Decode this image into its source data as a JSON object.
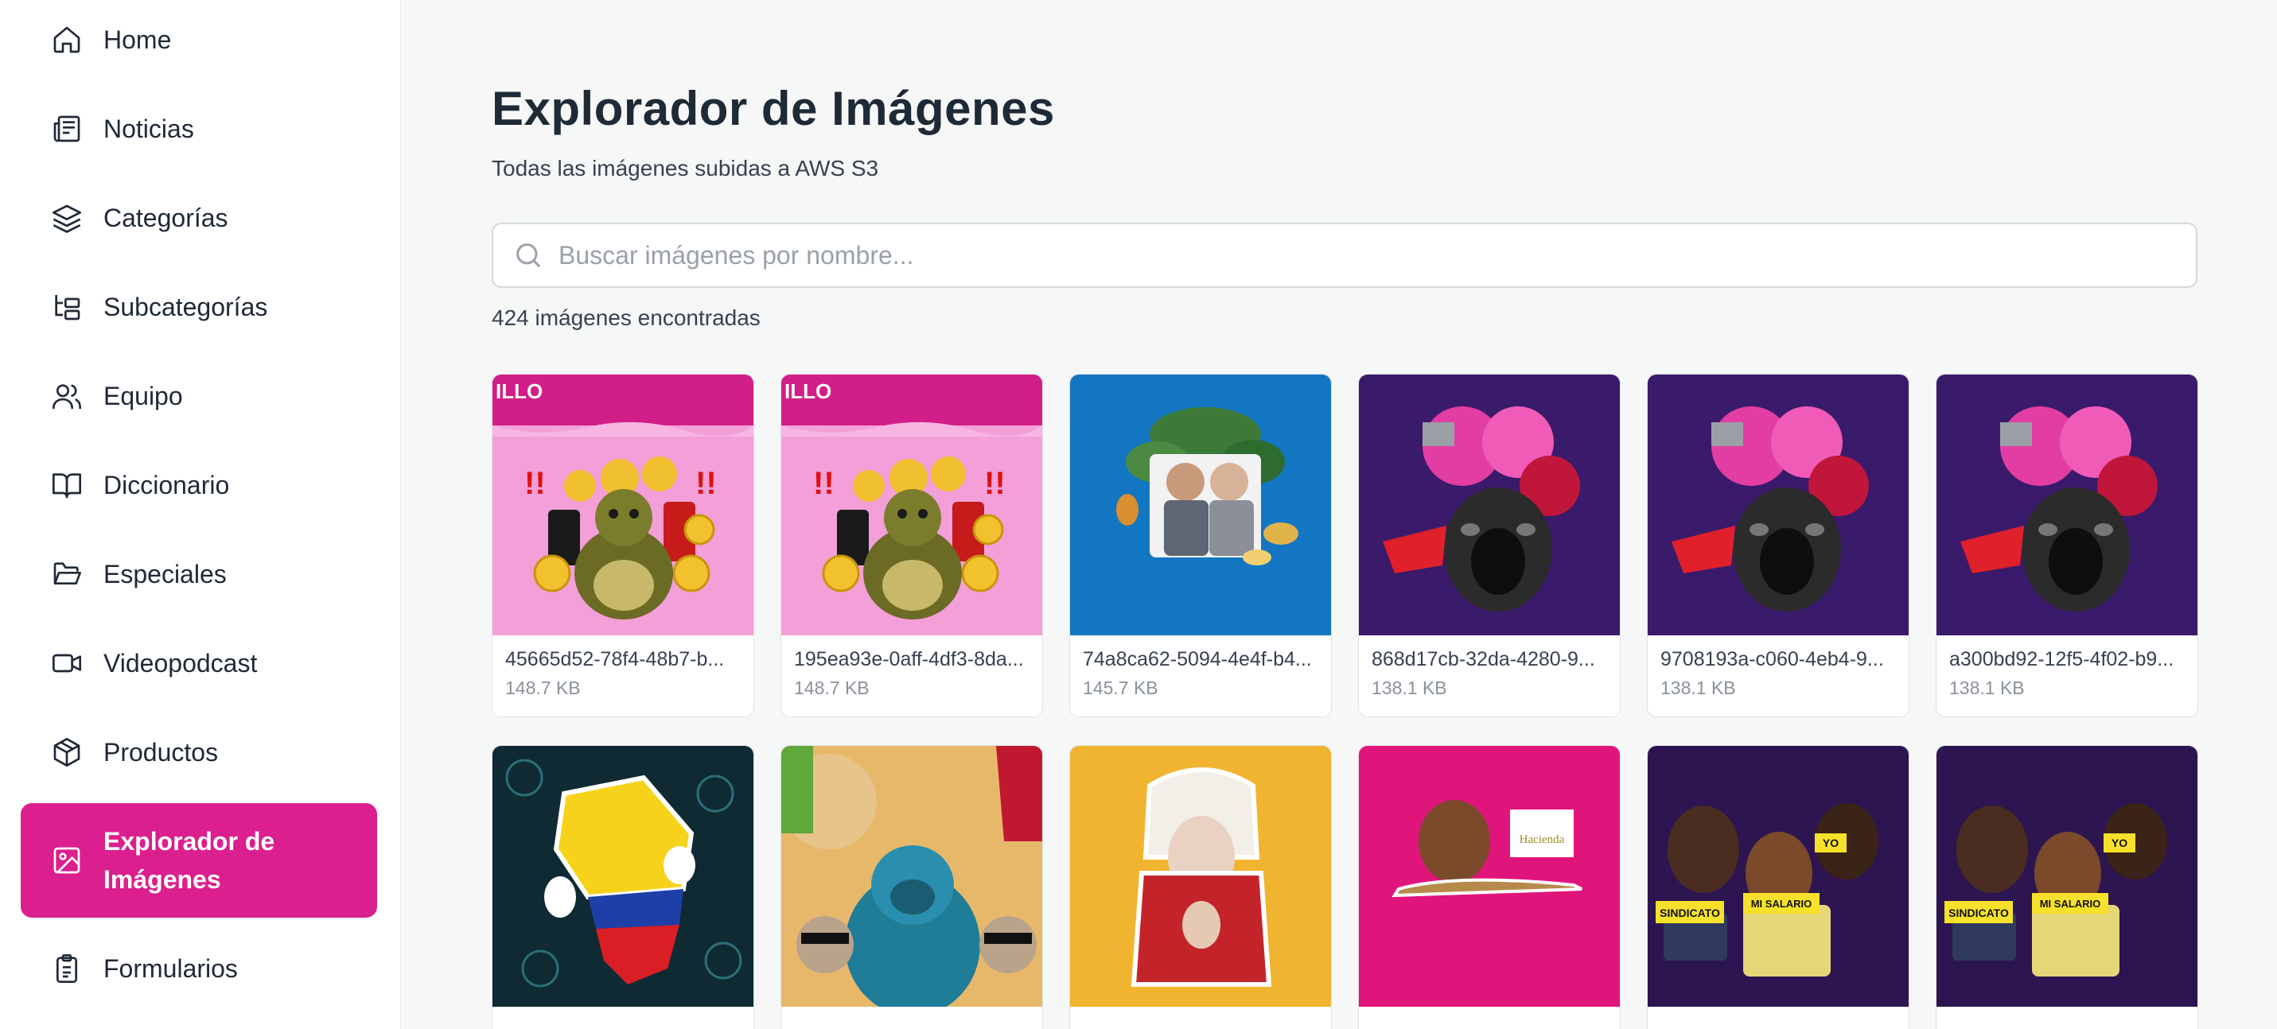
{
  "sidebar": {
    "items": [
      {
        "label": "Home",
        "icon": "home-icon"
      },
      {
        "label": "Noticias",
        "icon": "newspaper-icon"
      },
      {
        "label": "Categorías",
        "icon": "layers-icon"
      },
      {
        "label": "Subcategorías",
        "icon": "folder-tree-icon"
      },
      {
        "label": "Equipo",
        "icon": "users-icon"
      },
      {
        "label": "Diccionario",
        "icon": "book-icon"
      },
      {
        "label": "Especiales",
        "icon": "folder-open-icon"
      },
      {
        "label": "Videopodcast",
        "icon": "video-icon"
      },
      {
        "label": "Productos",
        "icon": "package-icon"
      },
      {
        "label": "Explorador de Imágenes",
        "icon": "image-icon",
        "active": true
      },
      {
        "label": "Formularios",
        "icon": "clipboard-icon"
      }
    ],
    "active_color": "#db1f8e"
  },
  "main": {
    "title": "Explorador de Imágenes",
    "subtitle": "Todas las imágenes subidas a AWS S3",
    "search": {
      "placeholder": "Buscar imágenes por nombre...",
      "value": ""
    },
    "result_count": "424 imágenes encontradas",
    "images": [
      {
        "name": "45665d52-78f4-48b7-b...",
        "size": "148.7 KB",
        "thumb": "pink-turtle-collage",
        "bg": "#f39fd8"
      },
      {
        "name": "195ea93e-0aff-4df3-8da...",
        "size": "148.7 KB",
        "thumb": "pink-turtle-collage",
        "bg": "#f39fd8"
      },
      {
        "name": "74a8ca62-5094-4e4f-b4...",
        "size": "145.7 KB",
        "thumb": "blue-politicians-collage",
        "bg": "#1376c2"
      },
      {
        "name": "868d17cb-32da-4280-9...",
        "size": "138.1 KB",
        "thumb": "purple-scream-collage",
        "bg": "#3a1a6b"
      },
      {
        "name": "9708193a-c060-4eb4-9...",
        "size": "138.1 KB",
        "thumb": "purple-scream-collage",
        "bg": "#3a1a6b"
      },
      {
        "name": "a300bd92-12f5-4f02-b9...",
        "size": "138.1 KB",
        "thumb": "purple-scream-collage",
        "bg": "#3a1a6b"
      },
      {
        "name": "",
        "size": "",
        "thumb": "colombia-map-collage",
        "bg": "#0f2a33"
      },
      {
        "name": "",
        "size": "",
        "thumb": "monkey-collage",
        "bg": "#e8b86a"
      },
      {
        "name": "",
        "size": "",
        "thumb": "portrait-collage",
        "bg": "#f0b431"
      },
      {
        "name": "",
        "size": "",
        "thumb": "hacienda-collage",
        "bg": "#e0157c"
      },
      {
        "name": "",
        "size": "",
        "thumb": "sindicato-collage",
        "bg": "#2c1550"
      },
      {
        "name": "",
        "size": "",
        "thumb": "sindicato-collage",
        "bg": "#2c1550"
      }
    ],
    "thumb_labels": {
      "turtle": "ILLO",
      "hacienda": "Hacienda",
      "sindicato": "SINDICATO",
      "salario": "MI SALARIO",
      "yo": "YO"
    }
  }
}
